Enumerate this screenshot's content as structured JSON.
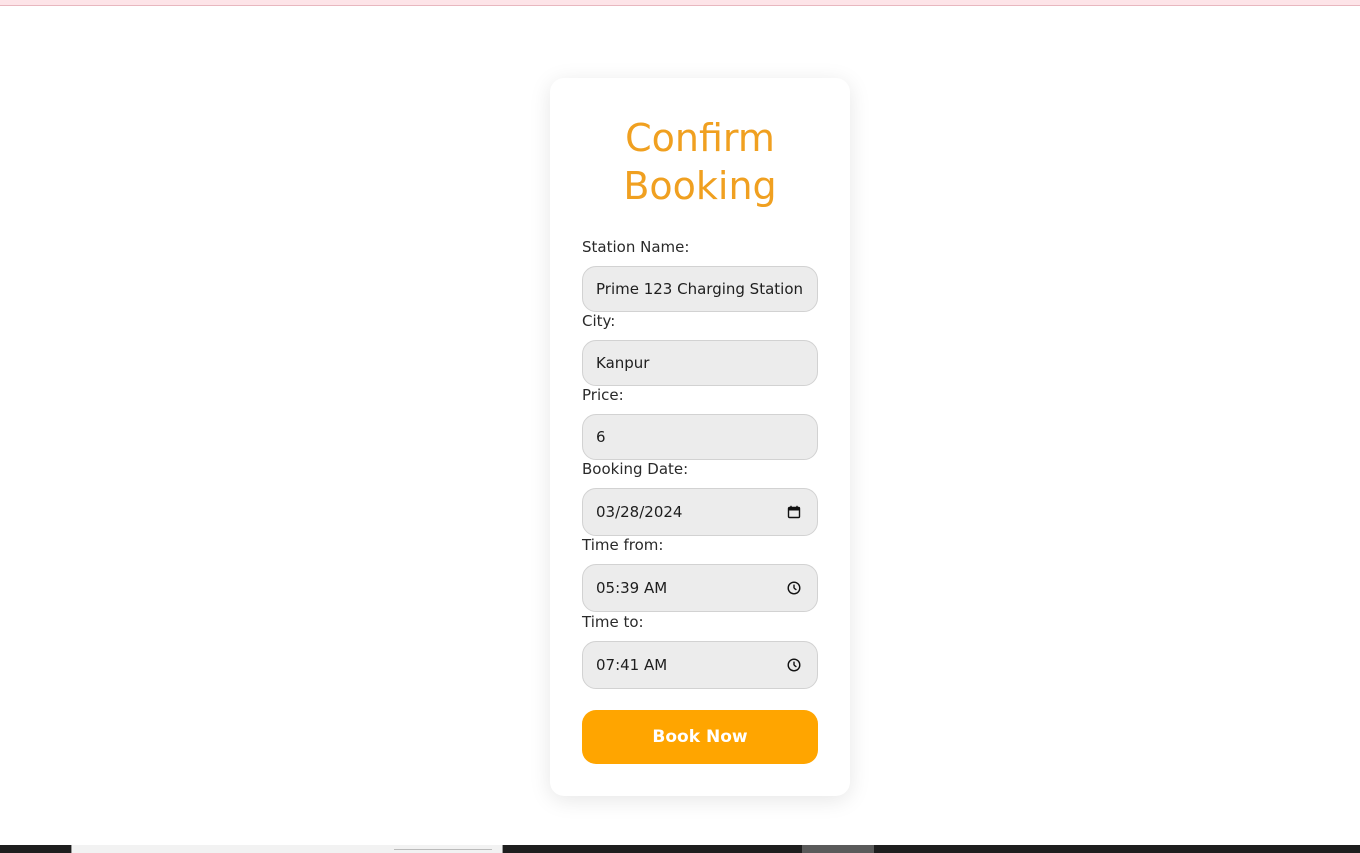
{
  "form": {
    "title_line1": "Confirm",
    "title_line2": "Booking",
    "station_label": "Station Name:",
    "station_value": "Prime 123 Charging Station",
    "city_label": "City:",
    "city_value": "Kanpur",
    "price_label": "Price:",
    "price_value": "6",
    "date_label": "Booking Date:",
    "date_value": "03/28/2024",
    "time_from_label": "Time from:",
    "time_from_value": "05:39 AM",
    "time_to_label": "Time to:",
    "time_to_value": "07:41 AM",
    "submit_label": "Book Now"
  },
  "icons": {
    "date_field_icon": "calendar-icon",
    "time_from_icon": "clock-icon",
    "time_to_icon": "clock-icon"
  },
  "colors": {
    "title": "#f0a020",
    "button": "#ffa500",
    "field_background": "#ececec",
    "top_strip": "#fde4e8"
  }
}
